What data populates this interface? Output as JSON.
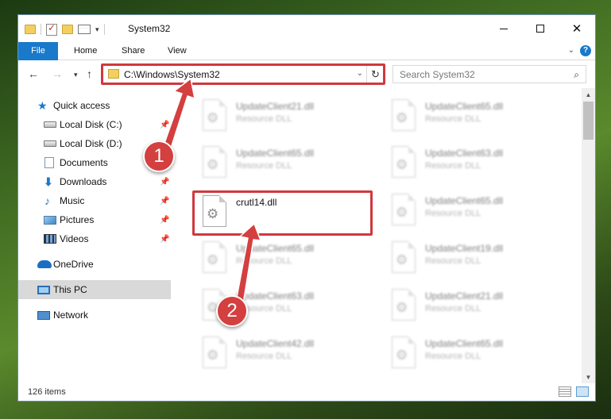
{
  "window": {
    "title": "System32",
    "controls": {
      "minimize": "",
      "maximize": "",
      "close": "✕"
    }
  },
  "ribbon": {
    "tabs": [
      "File",
      "Home",
      "Share",
      "View"
    ],
    "help": "?"
  },
  "nav": {
    "address": "C:\\Windows\\System32",
    "search_placeholder": "Search System32"
  },
  "sidebar": {
    "items": [
      {
        "label": "Quick access",
        "icon": "star-icon",
        "pinned": false
      },
      {
        "label": "Local Disk (C:)",
        "icon": "drive-icon",
        "pinned": true
      },
      {
        "label": "Local Disk (D:)",
        "icon": "drive-icon",
        "pinned": false
      },
      {
        "label": "Documents",
        "icon": "documents-icon",
        "pinned": true
      },
      {
        "label": "Downloads",
        "icon": "download-icon",
        "pinned": true
      },
      {
        "label": "Music",
        "icon": "music-icon",
        "pinned": true
      },
      {
        "label": "Pictures",
        "icon": "pictures-icon",
        "pinned": true
      },
      {
        "label": "Videos",
        "icon": "videos-icon",
        "pinned": true
      },
      {
        "label": "OneDrive",
        "icon": "onedrive-icon",
        "pinned": false
      },
      {
        "label": "This PC",
        "icon": "pc-icon",
        "pinned": false,
        "selected": true
      },
      {
        "label": "Network",
        "icon": "network-icon",
        "pinned": false
      }
    ]
  },
  "files": {
    "left": [
      {
        "name": "UpdateClient21.dll",
        "type": "Resource DLL"
      },
      {
        "name": "UpdateClient65.dll",
        "type": "Resource DLL"
      },
      {
        "name": "crutl14.dll",
        "type": ""
      },
      {
        "name": "UpdateClient65.dll",
        "type": "Resource DLL"
      },
      {
        "name": "UpdateClient63.dll",
        "type": "Resource DLL"
      },
      {
        "name": "UpdateClient42.dll",
        "type": "Resource DLL"
      }
    ],
    "right": [
      {
        "name": "UpdateClient65.dll",
        "type": "Resource DLL"
      },
      {
        "name": "UpdateClient63.dll",
        "type": "Resource DLL"
      },
      {
        "name": "UpdateClient65.dll",
        "type": "Resource DLL"
      },
      {
        "name": "UpdateClient19.dll",
        "type": "Resource DLL"
      },
      {
        "name": "UpdateClient21.dll",
        "type": "Resource DLL"
      },
      {
        "name": "UpdateClient65.dll",
        "type": "Resource DLL"
      }
    ]
  },
  "status": {
    "items_count": "126 items"
  },
  "annotations": {
    "step1": "1",
    "step2": "2",
    "color": "#d0383d"
  }
}
